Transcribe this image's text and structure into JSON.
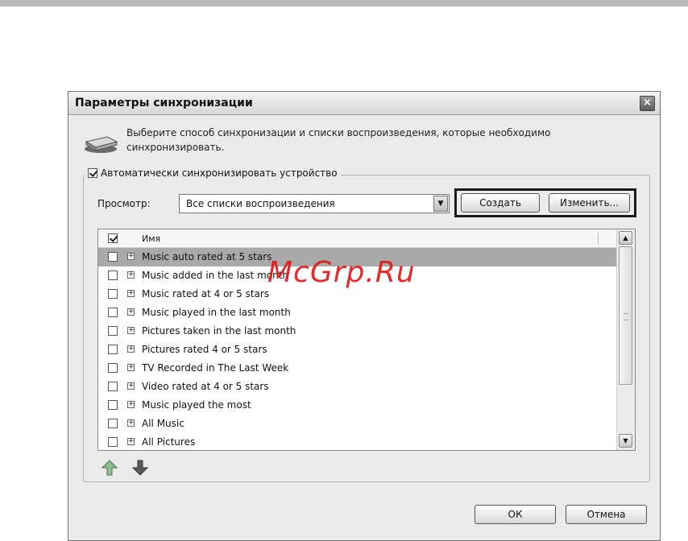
{
  "dialog": {
    "title": "Параметры синхронизации",
    "instruction": "Выберите способ синхронизации и списки воспроизведения, которые необходимо синхронизировать.",
    "auto_sync": {
      "label": "Автоматически синхронизировать устройство",
      "checked": true
    },
    "view": {
      "label": "Просмотр:",
      "selected": "Все списки воспроизведения"
    },
    "buttons": {
      "create": "Создать",
      "edit": "Изменить...",
      "ok": "ОК",
      "cancel": "Отмена"
    },
    "list": {
      "header_label": "Имя",
      "header_checked": true,
      "items": [
        {
          "label": "Music auto rated at 5 stars",
          "checked": false,
          "selected": true
        },
        {
          "label": "Music added in the last month",
          "checked": false,
          "selected": false
        },
        {
          "label": "Music rated at 4 or 5 stars",
          "checked": false,
          "selected": false
        },
        {
          "label": "Music played in the last month",
          "checked": false,
          "selected": false
        },
        {
          "label": "Pictures taken in the last month",
          "checked": false,
          "selected": false
        },
        {
          "label": "Pictures rated 4 or 5 stars",
          "checked": false,
          "selected": false
        },
        {
          "label": "TV Recorded in The Last Week",
          "checked": false,
          "selected": false
        },
        {
          "label": "Video rated at 4 or 5 stars",
          "checked": false,
          "selected": false
        },
        {
          "label": "Music played the most",
          "checked": false,
          "selected": false
        },
        {
          "label": "All Music",
          "checked": false,
          "selected": false
        },
        {
          "label": "All Pictures",
          "checked": false,
          "selected": false
        }
      ]
    }
  },
  "watermark": "McGrp.Ru",
  "icons": {
    "device": "portable-device-icon",
    "move_up": "green-up-arrow-icon",
    "move_down": "green-down-arrow-icon",
    "close": "close-icon"
  },
  "colors": {
    "selection": "#a9a9a9",
    "watermark": "#e11919",
    "highlight_frame": "#1a1a1a"
  }
}
